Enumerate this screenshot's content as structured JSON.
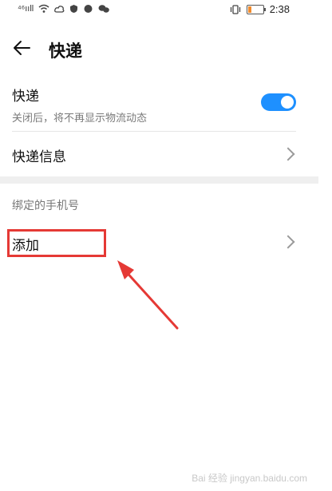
{
  "status_bar": {
    "signal_text": "⁴⁶ııll",
    "time": "2:38",
    "icons": [
      "signal-icon",
      "wifi-icon",
      "cloud-icon",
      "shield-icon",
      "chat-icon",
      "vibrate-icon",
      "battery-icon"
    ]
  },
  "header": {
    "title": "快递"
  },
  "settings": {
    "express_toggle": {
      "title": "快递",
      "subtitle": "关闭后，将不再显示物流动态",
      "enabled": true
    },
    "express_info_label": "快递信息"
  },
  "phone_section": {
    "label": "绑定的手机号",
    "add_label": "添加"
  },
  "annotation": {
    "box_color": "#e53935"
  },
  "watermark": "Bai 经验 jingyan.baidu.com",
  "colors": {
    "accent": "#1e90ff",
    "annotation_red": "#e53935"
  }
}
